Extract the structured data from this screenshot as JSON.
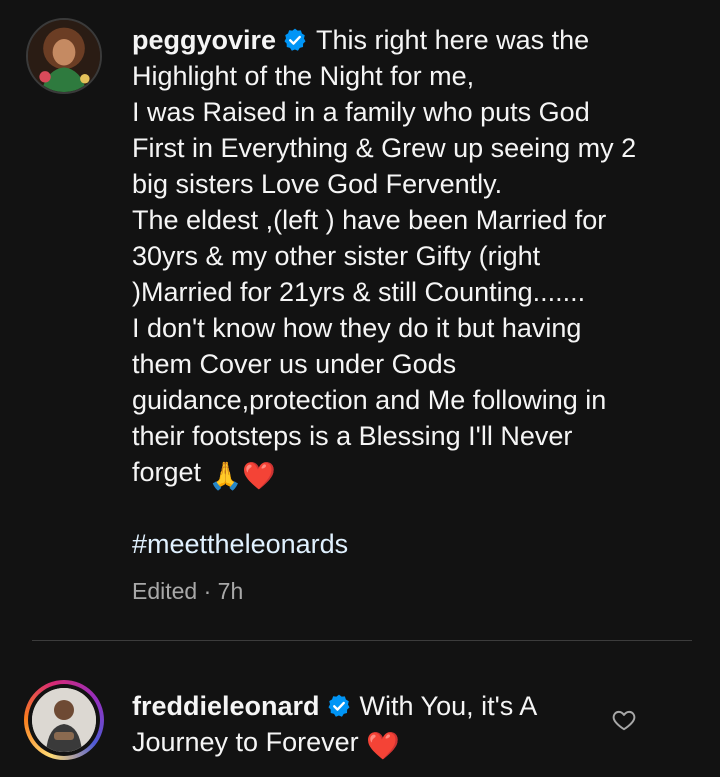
{
  "post": {
    "username": "peggyovire",
    "caption_lines": [
      "This right here was the",
      "Highlight of the Night for me,",
      "I was Raised in a family who puts God",
      "First in Everything & Grew up seeing my 2",
      "big sisters Love God Fervently.",
      "The eldest ,(left ) have been Married for",
      "30yrs & my other sister Gifty (right",
      ")Married for 21yrs & still Counting.......",
      "I don't know how they do it but having",
      "them Cover us under Gods",
      "guidance,protection and Me following in",
      "their footsteps is a Blessing I'll Never",
      "forget "
    ],
    "caption_emoji": "🙏❤️",
    "hashtag": "#meettheleonards",
    "edited_label": "Edited",
    "separator": "·",
    "time_ago": "7h",
    "verified_icon": "verified-badge-icon",
    "avatar_icon": "profile-avatar"
  },
  "comment": {
    "username": "freddieleonard",
    "text_line1": "With You, it's A",
    "text_line2": "Journey to Forever ",
    "emoji": "❤️",
    "verified_icon": "verified-badge-icon",
    "like_icon": "heart-outline-icon"
  },
  "colors": {
    "background": "#121212",
    "text": "#f5f5f5",
    "muted": "#a8a8a8",
    "hashtag": "#e0f1ff",
    "verified": "#0095f6",
    "divider": "#3c3c3c"
  }
}
